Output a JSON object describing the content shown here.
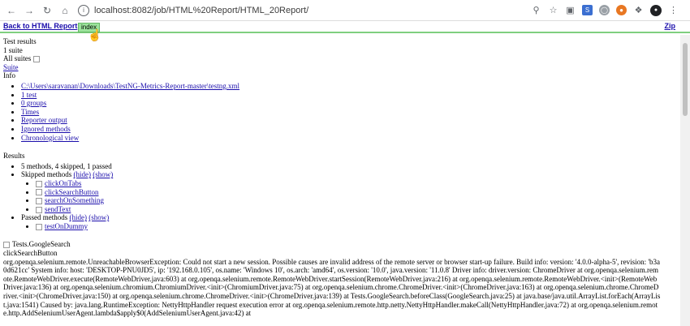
{
  "browser": {
    "url": "localhost:8082/job/HTML%20Report/HTML_20Report/"
  },
  "topbar": {
    "back_label": "Back to HTML Report",
    "index_label": "index",
    "zip_label": "Zip"
  },
  "summary": {
    "test_results": "Test results",
    "suite_count": "1 suite",
    "all_suites": "All suites",
    "suite_link": "Suite",
    "info": "Info"
  },
  "info_links": [
    "C:\\Users\\saravanan\\Downloads\\TestNG-Metrics-Report-master\\testng.xml",
    "1 test",
    "0 groups",
    "Times",
    "Reporter output",
    "Ignored methods",
    "Chronological view"
  ],
  "results": {
    "title": "Results",
    "summary_line": "5 methods, 4 skipped, 1 passed",
    "skipped_label": "Skipped methods",
    "hide": "(hide)",
    "show": "(show)",
    "skipped_methods": [
      "clickOnTabs",
      "clickSearchButton",
      "searchOnSomething",
      "sendText"
    ],
    "passed_label": "Passed methods",
    "passed_methods": [
      "testOnDummy"
    ]
  },
  "detail": {
    "class_name": "Tests.GoogleSearch",
    "method_name": "clickSearchButton",
    "error_text": "org.openqa.selenium.remote.UnreachableBrowserException: Could not start a new session. Possible causes are invalid address of the remote server or browser start-up failure. Build info: version: '4.0.0-alpha-5', revision: 'b3a0d621cc' System info: host: 'DESKTOP-PNU0JD5', ip: '192.168.0.105', os.name: 'Windows 10', os.arch: 'amd64', os.version: '10.0', java.version: '11.0.8' Driver info: driver.version: ChromeDriver at org.openqa.selenium.remote.RemoteWebDriver.execute(RemoteWebDriver.java:603) at org.openqa.selenium.remote.RemoteWebDriver.startSession(RemoteWebDriver.java:216) at org.openqa.selenium.remote.RemoteWebDriver.<init>(RemoteWebDriver.java:136) at org.openqa.selenium.chromium.ChromiumDriver.<init>(ChromiumDriver.java:75) at org.openqa.selenium.chrome.ChromeDriver.<init>(ChromeDriver.java:163) at org.openqa.selenium.chrome.ChromeDriver.<init>(ChromeDriver.java:150) at org.openqa.selenium.chrome.ChromeDriver.<init>(ChromeDriver.java:139) at Tests.GoogleSearch.beforeClass(GoogleSearch.java:25) at java.base/java.util.ArrayList.forEach(ArrayList.java:1541) Caused by: java.lang.RuntimeException: NettyHttpHandler request execution error at org.openqa.selenium.remote.http.netty.NettyHttpHandler.makeCall(NettyHttpHandler.java:72) at org.openqa.selenium.remote.http.AddSeleniumUserAgent.lambda$apply$0(AddSeleniumUserAgent.java:42) at"
  }
}
